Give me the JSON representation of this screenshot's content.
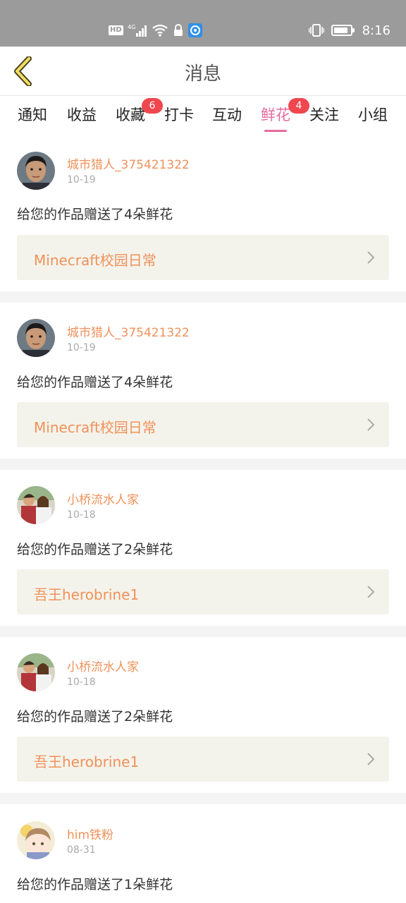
{
  "status_bar": {
    "hd": "HD",
    "network": "4G",
    "time": "8:16"
  },
  "header": {
    "title": "消息"
  },
  "tabs": [
    {
      "label": "通知",
      "badge": ""
    },
    {
      "label": "收益",
      "badge": ""
    },
    {
      "label": "收藏",
      "badge": "6"
    },
    {
      "label": "打卡",
      "badge": ""
    },
    {
      "label": "互动",
      "badge": ""
    },
    {
      "label": "鲜花",
      "badge": "4",
      "active": true
    },
    {
      "label": "关注",
      "badge": ""
    },
    {
      "label": "小组",
      "badge": ""
    }
  ],
  "colors": {
    "accent": "#e86a9e",
    "name": "#f0915a",
    "badge": "#f0474f"
  },
  "messages": [
    {
      "user": "城市猎人_375421322",
      "date": "10-19",
      "text": "给您的作品赠送了4朵鲜花",
      "work": "Minecraft校园日常",
      "avatar": "boy-avatar"
    },
    {
      "user": "城市猎人_375421322",
      "date": "10-19",
      "text": "给您的作品赠送了4朵鲜花",
      "work": "Minecraft校园日常",
      "avatar": "boy-avatar"
    },
    {
      "user": "小桥流水人家",
      "date": "10-18",
      "text": "给您的作品赠送了2朵鲜花",
      "work": "吾王herobrine1",
      "avatar": "couple-avatar"
    },
    {
      "user": "小桥流水人家",
      "date": "10-18",
      "text": "给您的作品赠送了2朵鲜花",
      "work": "吾王herobrine1",
      "avatar": "couple-avatar"
    },
    {
      "user": "him铁粉",
      "date": "08-31",
      "text": "给您的作品赠送了1朵鲜花",
      "work": "",
      "avatar": "anime-avatar"
    }
  ]
}
